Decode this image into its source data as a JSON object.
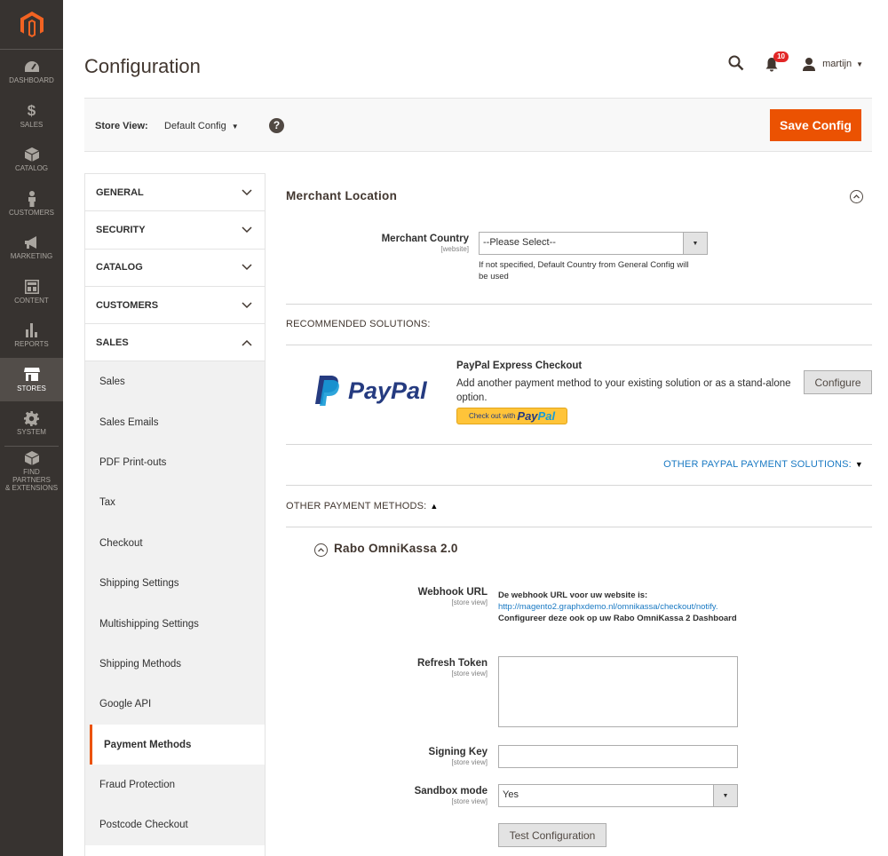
{
  "menu": {
    "items": [
      {
        "label": "DASHBOARD",
        "icon": "dashboard-icon"
      },
      {
        "label": "SALES",
        "icon": "dollar-icon"
      },
      {
        "label": "CATALOG",
        "icon": "box-icon"
      },
      {
        "label": "CUSTOMERS",
        "icon": "person-icon"
      },
      {
        "label": "MARKETING",
        "icon": "megaphone-icon"
      },
      {
        "label": "CONTENT",
        "icon": "layout-icon"
      },
      {
        "label": "REPORTS",
        "icon": "bar-chart-icon"
      },
      {
        "label": "STORES",
        "icon": "store-icon",
        "active": true
      },
      {
        "label": "SYSTEM",
        "icon": "gear-icon"
      }
    ],
    "partners_line1": "FIND PARTNERS",
    "partners_line2": "& EXTENSIONS"
  },
  "header": {
    "title": "Configuration",
    "notification_count": "10",
    "user_name": "martijn"
  },
  "scope": {
    "label": "Store View:",
    "value": "Default Config",
    "help": "?",
    "save_label": "Save Config"
  },
  "tabs": {
    "groups": [
      "GENERAL",
      "SECURITY",
      "CATALOG",
      "CUSTOMERS",
      "SALES"
    ],
    "sales_items": [
      "Sales",
      "Sales Emails",
      "PDF Print-outs",
      "Tax",
      "Checkout",
      "Shipping Settings",
      "Multishipping Settings",
      "Shipping Methods",
      "Google API",
      "Payment Methods",
      "Fraud Protection",
      "Postcode Checkout"
    ]
  },
  "merchant": {
    "title": "Merchant Location",
    "country_label": "Merchant Country",
    "country_scope": "[website]",
    "country_value": "--Please Select--",
    "country_note_1": "If not specified, Default Country from General Config will",
    "country_note_2": "be used"
  },
  "recommended": {
    "heading": "RECOMMENDED SOLUTIONS:",
    "paypal_logo": "PayPal",
    "title": "PayPal Express Checkout",
    "desc": "Add another payment method to your existing solution or as a stand-alone option.",
    "btn_small": "Check out with",
    "btn_brand_a": "Pay",
    "btn_brand_b": "Pal",
    "configure_label": "Configure",
    "other_pp": "OTHER PAYPAL PAYMENT SOLUTIONS:",
    "other_pm": "OTHER PAYMENT METHODS:"
  },
  "rabo": {
    "title": "Rabo OmniKassa 2.0",
    "webhook_label": "Webhook URL",
    "webhook_scope": "[store view]",
    "webhook_intro": "De webhook URL voor uw website is:",
    "webhook_url": "http://magento2.graphxdemo.nl/omnikassa/checkout/notify.",
    "webhook_outro": "Configureer deze ook op uw Rabo OmniKassa 2 Dashboard",
    "refresh_label": "Refresh Token",
    "refresh_scope": "[store view]",
    "signing_label": "Signing Key",
    "signing_scope": "[store view]",
    "sandbox_label": "Sandbox mode",
    "sandbox_scope": "[store view]",
    "sandbox_value": "Yes",
    "test_label": "Test Configuration"
  },
  "colors": {
    "accent": "#eb5202",
    "menu_bg": "#373330",
    "link": "#1979c3"
  }
}
